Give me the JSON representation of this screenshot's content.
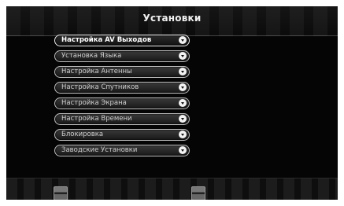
{
  "screen": {
    "title": "Установки"
  },
  "menu": {
    "items": [
      {
        "label": "Настройка AV Выходов",
        "selected": true
      },
      {
        "label": "Установка Языка",
        "selected": false
      },
      {
        "label": "Настройка Антенны",
        "selected": false
      },
      {
        "label": "Настройка Спутников",
        "selected": false
      },
      {
        "label": "Настройка Экрана",
        "selected": false
      },
      {
        "label": "Настройка Времени",
        "selected": false
      },
      {
        "label": "Блокировка",
        "selected": false
      },
      {
        "label": "Заводские Установки",
        "selected": false
      }
    ],
    "item_icon": "chevron-down-circle-icon"
  },
  "footer": {
    "keys": [
      "color-key-icon",
      "color-key-icon"
    ]
  },
  "colors": {
    "background": "#050505",
    "item_border": "#bdbdbd",
    "selected_border": "#f0f0f0",
    "text": "#cfcfcf"
  }
}
